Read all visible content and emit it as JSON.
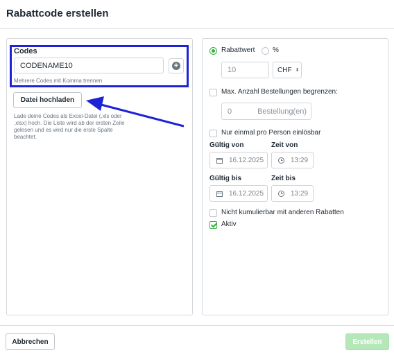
{
  "dialog": {
    "title": "Rabattcode erstellen"
  },
  "codes": {
    "label": "Codes",
    "value": "CODENAME10",
    "hint": "Mehrere Codes mit Komma trennen",
    "upload_label": "Datei hochladen",
    "upload_help": "Lade deine Codes als Excel-Datei (.xls oder .xlsx) hoch. Die Liste wird ab der ersten Zeile gelesen und es wird nur die erste Spalte beachtet."
  },
  "discount": {
    "option_value_label": "Rabattwert",
    "option_percent_label": "%",
    "amount_placeholder": "10",
    "currency": "CHF"
  },
  "max_orders": {
    "label": "Max. Anzahl Bestellungen begrenzen:",
    "value": "0",
    "unit": "Bestellung(en)"
  },
  "once_per_person": {
    "label": "Nur einmal pro Person einlösbar"
  },
  "valid_from": {
    "date_label": "Gültig von",
    "time_label": "Zeit von",
    "date": "16.12.2025",
    "time": "13:29"
  },
  "valid_until": {
    "date_label": "Gültig bis",
    "time_label": "Zeit bis",
    "date": "16.12.2025",
    "time": "13:29"
  },
  "not_cumulative": {
    "label": "Nicht kumulierbar mit anderen Rabatten"
  },
  "active": {
    "label": "Aktiv"
  },
  "footer": {
    "cancel_label": "Abbrechen",
    "create_label": "Erstellen"
  },
  "colors": {
    "accent_green": "#34b13e",
    "annotation_blue": "#1e22d6"
  }
}
